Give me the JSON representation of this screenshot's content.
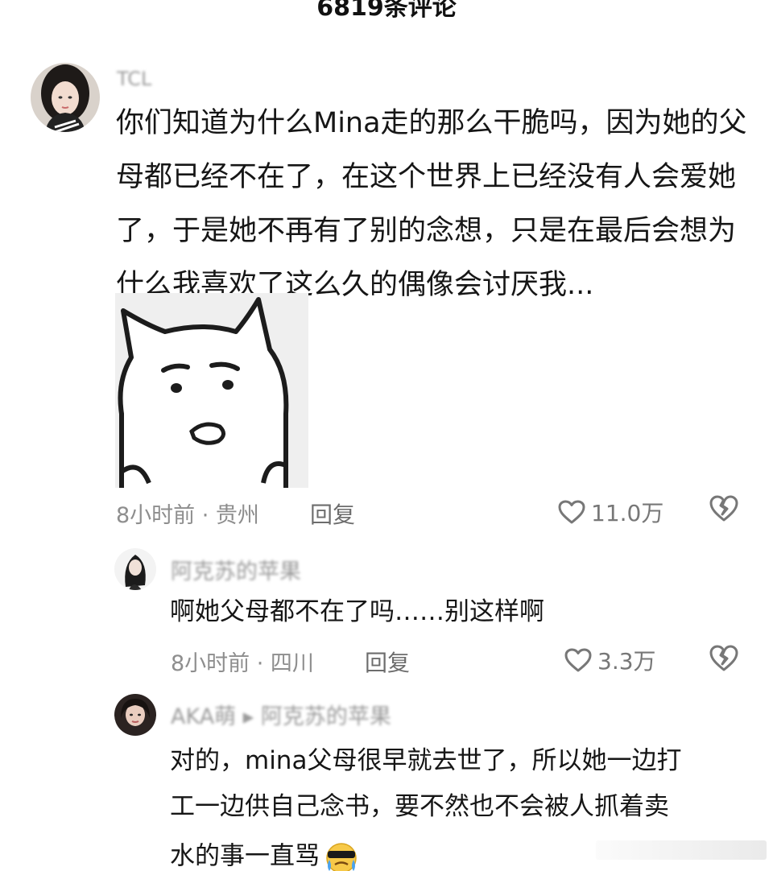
{
  "header": {
    "title": "6819条评论"
  },
  "comments": [
    {
      "username": "TCL",
      "lines": [
        "你们知道为什么Mina走的那么干脆吗，因为她的父",
        "母都已经不在了，在这个世界上已经没有人会爱她",
        "了，于是她不再有了别的念想，只是在最后会想为",
        "什么我喜欢了这么久的偶像会讨厌我..."
      ],
      "meta": "8小时前 · 贵州",
      "reply_label": "回复",
      "likes": "11.0万"
    },
    {
      "username": "阿克苏的苹果",
      "lines": [
        "啊她父母都不在了吗……别这样啊"
      ],
      "meta": "8小时前 · 四川",
      "reply_label": "回复",
      "likes": "3.3万"
    },
    {
      "username": "AKA萌 ▸ 阿克苏的苹果",
      "lines": [
        "对的，mina父母很早就去世了，所以她一边打",
        "工一边供自己念书，要不然也不会被人抓着卖",
        "水的事一直骂"
      ],
      "emoji": "cool-crying-emoji"
    }
  ],
  "icons": {
    "like": "heart-outline-icon",
    "dislike": "broken-heart-icon"
  },
  "colors": {
    "text": "#161616",
    "meta": "#8e8e8e",
    "icon": "#777777"
  }
}
